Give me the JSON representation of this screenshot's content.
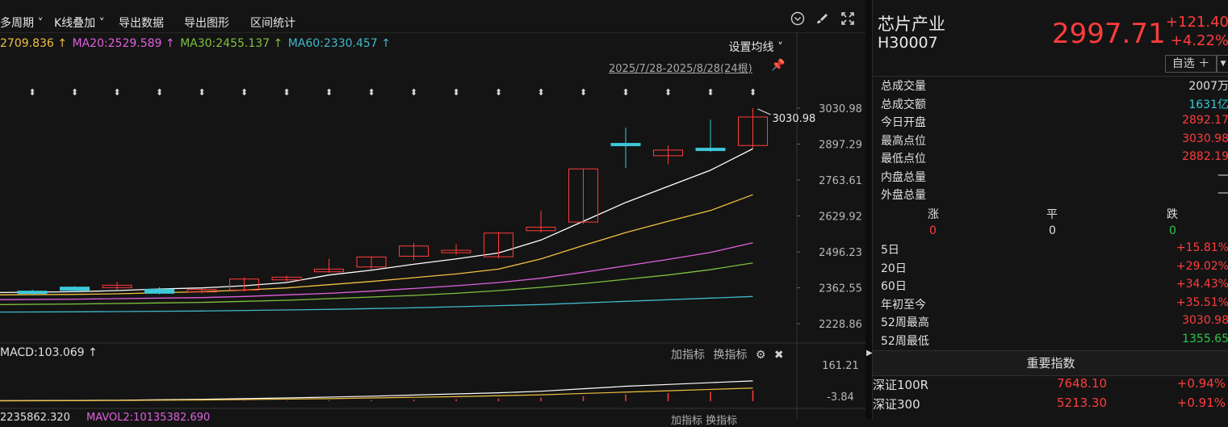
{
  "toolbar": {
    "period_label": "多周期 ˅",
    "kline_overlay": "K线叠加 ˅",
    "export_data": "导出数据",
    "export_chart": "导出图形",
    "range_stats": "区间统计"
  },
  "ma": {
    "ma10": "2709.836 ↑",
    "ma20": "MA20:2529.589 ↑",
    "ma30": "MA30:2455.137 ↑",
    "ma60": "MA60:2330.457 ↑",
    "setting": "设置均线 ˅",
    "colors": {
      "ma5": "#ffffff",
      "ma10": "#f0c040",
      "ma20": "#e060e0",
      "ma30": "#80c040",
      "ma60": "#40b8c8"
    }
  },
  "date_range": "2025/7/28-2025/8/28(24根)",
  "price_axis": [
    "3030.98",
    "2897.29",
    "2763.61",
    "2629.92",
    "2496.23",
    "2362.55",
    "2228.86"
  ],
  "high_marker": "3030.98",
  "macd": {
    "label": "MACD:103.069 ↑",
    "axis_top": "161.21",
    "axis_bottom": "-3.84",
    "add_indicator": "加指标",
    "change_indicator": "换指标"
  },
  "vol": {
    "label": "2235862.320",
    "mavol": "MAVOL2:10135382.690",
    "add_indicator": "加指标",
    "change_indicator": "换指标"
  },
  "chart_data": {
    "type": "candlestick",
    "ylim": [
      2228.86,
      3030.98
    ],
    "candles": [
      {
        "o": 2350,
        "h": 2355,
        "l": 2335,
        "c": 2343
      },
      {
        "o": 2365,
        "h": 2368,
        "l": 2345,
        "c": 2353
      },
      {
        "o": 2368,
        "h": 2385,
        "l": 2355,
        "c": 2372
      },
      {
        "o": 2357,
        "h": 2364,
        "l": 2338,
        "c": 2342
      },
      {
        "o": 2348,
        "h": 2360,
        "l": 2342,
        "c": 2356
      },
      {
        "o": 2354,
        "h": 2402,
        "l": 2348,
        "c": 2395
      },
      {
        "o": 2392,
        "h": 2408,
        "l": 2386,
        "c": 2402
      },
      {
        "o": 2422,
        "h": 2470,
        "l": 2418,
        "c": 2432
      },
      {
        "o": 2440,
        "h": 2479,
        "l": 2430,
        "c": 2477
      },
      {
        "o": 2480,
        "h": 2530,
        "l": 2465,
        "c": 2518
      },
      {
        "o": 2502,
        "h": 2525,
        "l": 2485,
        "c": 2502
      },
      {
        "o": 2478,
        "h": 2570,
        "l": 2472,
        "c": 2566
      },
      {
        "o": 2575,
        "h": 2650,
        "l": 2568,
        "c": 2588
      },
      {
        "o": 2607,
        "h": 2804,
        "l": 2600,
        "c": 2805
      },
      {
        "o": 2900,
        "h": 2958,
        "l": 2808,
        "c": 2892
      },
      {
        "o": 2854,
        "h": 2892,
        "l": 2822,
        "c": 2875
      },
      {
        "o": 2882,
        "h": 2988,
        "l": 2868,
        "c": 2878
      },
      {
        "o": 2892,
        "h": 3031,
        "l": 2882,
        "c": 2998
      }
    ],
    "ma_lines": {
      "ma5": [
        2345,
        2348,
        2352,
        2358,
        2362,
        2370,
        2382,
        2410,
        2428,
        2450,
        2470,
        2492,
        2540,
        2610,
        2680,
        2740,
        2800,
        2880
      ],
      "ma10": [
        2336,
        2338,
        2340,
        2344,
        2348,
        2354,
        2362,
        2374,
        2386,
        2400,
        2414,
        2432,
        2470,
        2520,
        2568,
        2610,
        2650,
        2709
      ],
      "ma20": [
        2318,
        2320,
        2322,
        2324,
        2326,
        2330,
        2336,
        2342,
        2350,
        2360,
        2370,
        2382,
        2398,
        2420,
        2444,
        2468,
        2494,
        2530
      ],
      "ma30": [
        2300,
        2302,
        2304,
        2306,
        2308,
        2312,
        2316,
        2322,
        2328,
        2334,
        2342,
        2352,
        2364,
        2378,
        2394,
        2410,
        2430,
        2455
      ],
      "ma60": [
        2272,
        2273,
        2274,
        2275,
        2276,
        2278,
        2280,
        2282,
        2285,
        2288,
        2292,
        2296,
        2300,
        2306,
        2312,
        2318,
        2324,
        2330
      ]
    }
  },
  "info": {
    "name": "芯片产业",
    "code": "H30007",
    "price": "2997.71",
    "change": "+121.40",
    "change_pct": "+4.22%",
    "watch_label": "自选 ＋",
    "stats": [
      {
        "label": "总成交量",
        "value": "2007万",
        "color": "white"
      },
      {
        "label": "总成交额",
        "value": "1631亿",
        "color": "cyan"
      },
      {
        "label": "今日开盘",
        "value": "2892.17",
        "color": "red"
      },
      {
        "label": "最高点位",
        "value": "3030.98",
        "color": "red"
      },
      {
        "label": "最低点位",
        "value": "2882.19",
        "color": "red"
      },
      {
        "label": "内盘总量",
        "value": "—",
        "color": "white"
      },
      {
        "label": "外盘总量",
        "value": "—",
        "color": "white"
      }
    ],
    "breadth": {
      "up_label": "涨",
      "flat_label": "平",
      "down_label": "跌",
      "up": "0",
      "flat": "0",
      "down": "0"
    },
    "periods": [
      {
        "label": "5日",
        "value": "+15.81%",
        "color": "red"
      },
      {
        "label": "20日",
        "value": "+29.02%",
        "color": "red"
      },
      {
        "label": "60日",
        "value": "+34.43%",
        "color": "red"
      },
      {
        "label": "年初至今",
        "value": "+35.51%",
        "color": "red"
      },
      {
        "label": "52周最高",
        "value": "3030.98",
        "color": "red"
      },
      {
        "label": "52周最低",
        "value": "1355.65",
        "color": "green"
      }
    ],
    "index_header": "重要指数",
    "indices": [
      {
        "name": "深证100R",
        "value": "7648.10",
        "pct": "+0.94%"
      },
      {
        "name": "深证300",
        "value": "5213.30",
        "pct": "+0.91%"
      }
    ]
  }
}
